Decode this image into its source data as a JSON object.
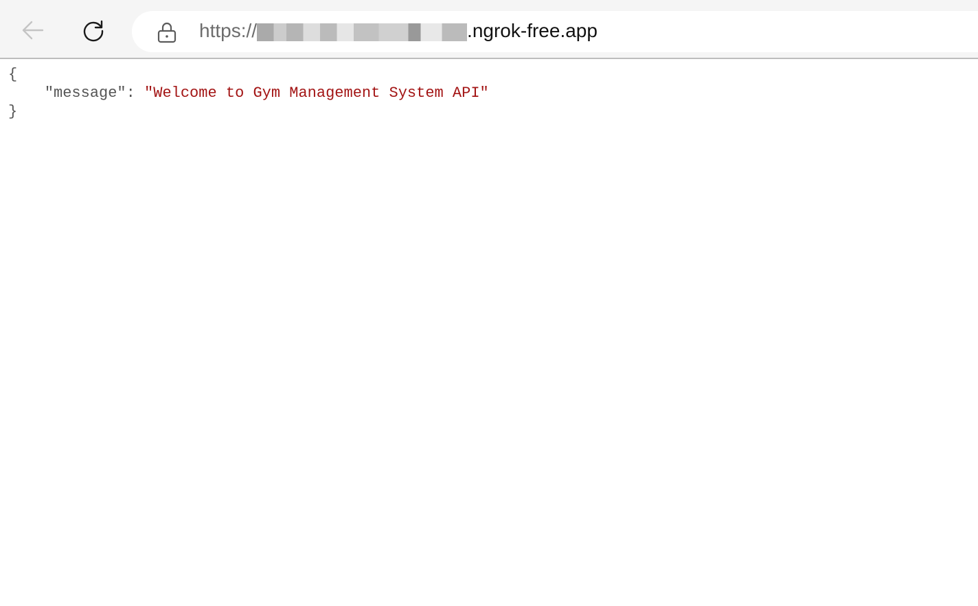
{
  "browser": {
    "back_icon": "arrow-left-icon",
    "reload_icon": "reload-icon",
    "lock_icon": "lock-icon",
    "url": {
      "scheme": "https://",
      "redacted_host": "[redacted]",
      "domain_suffix": ".ngrok-free.app"
    }
  },
  "content": {
    "open_brace": "{",
    "key": "\"message\"",
    "separator": ": ",
    "value": "\"Welcome to Gym Management System API\"",
    "close_brace": "}"
  },
  "colors": {
    "toolbar_bg": "#f5f5f5",
    "json_key": "#555555",
    "json_string": "#a31515"
  }
}
